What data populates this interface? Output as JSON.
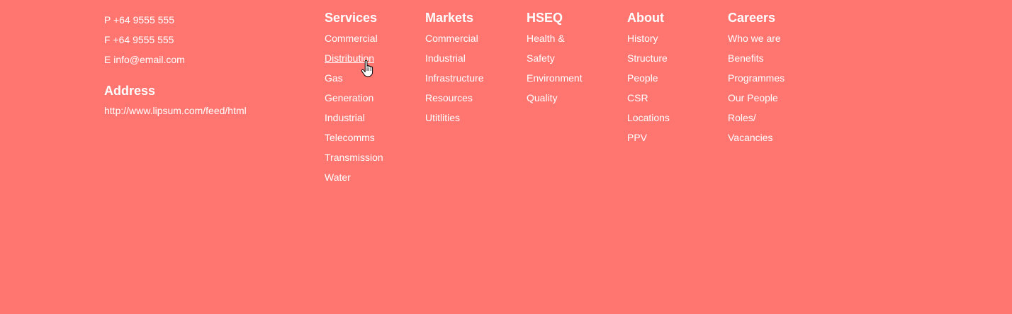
{
  "contact": {
    "phone": "P +64 9555 555",
    "fax": "F +64 9555 555",
    "email": "E info@email.com",
    "address_title": "Address",
    "address_url": "http://www.lipsum.com/feed/html"
  },
  "columns": {
    "services": {
      "heading": "Services",
      "items": [
        "Commercial",
        "Distribution",
        "Gas",
        "Generation",
        "Industrial",
        "Telecomms",
        "Transmission",
        "Water"
      ]
    },
    "markets": {
      "heading": "Markets",
      "items": [
        "Commercial",
        "Industrial",
        "Infrastructure",
        "Resources",
        "Utitlities"
      ]
    },
    "hseq": {
      "heading": "HSEQ",
      "items": [
        "Health &",
        "Safety",
        "Environment",
        "Quality"
      ]
    },
    "about": {
      "heading": "About",
      "items": [
        "History",
        "Structure",
        "People",
        "CSR",
        "Locations",
        "PPV"
      ]
    },
    "careers": {
      "heading": "Careers",
      "items": [
        "Who we are",
        "Benefits",
        "Programmes",
        "Our People",
        "Roles/",
        "Vacancies"
      ]
    }
  },
  "colors": {
    "background": "#ff7570",
    "text": "#ffffff"
  },
  "cursor": {
    "icon": "hand-pointer-icon",
    "hovered_item": "Distribution"
  }
}
